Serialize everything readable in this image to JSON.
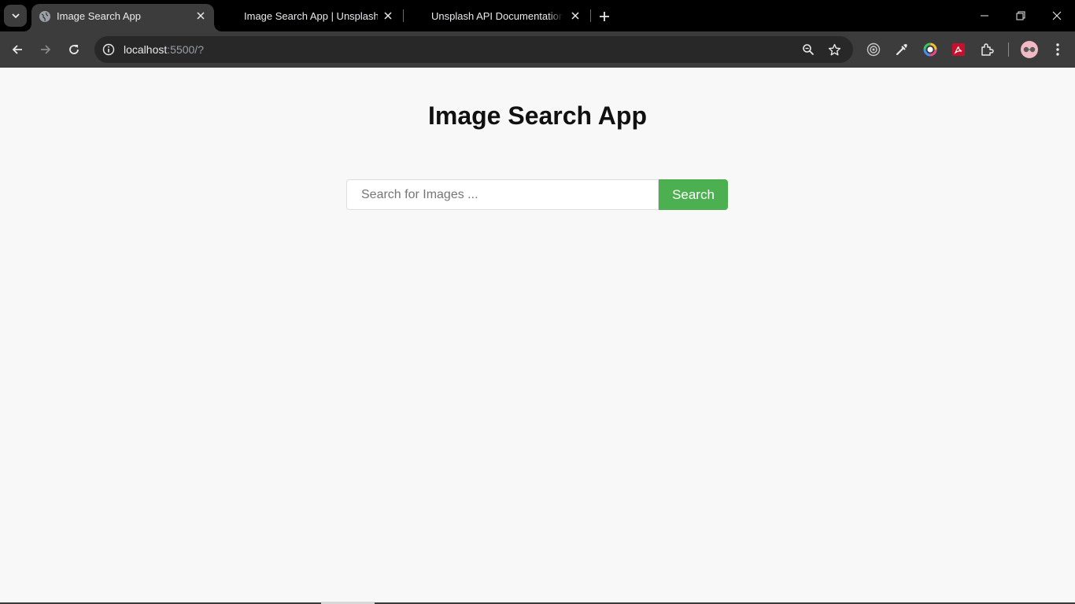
{
  "browser": {
    "tabs": [
      {
        "title": "Image Search App",
        "active": true
      },
      {
        "title": "Image Search App | Unsplash",
        "active": false
      },
      {
        "title": "Unsplash API Documentation | Free HD Photo API | Unsplash",
        "active": false
      }
    ],
    "address": {
      "host": "localhost",
      "rest": ":5500/?"
    },
    "icons": {
      "tab_search": "chevron-down-icon",
      "new_tab": "plus-icon",
      "minimize": "minimize-icon",
      "restore": "restore-icon",
      "close": "close-icon",
      "back": "arrow-left-icon",
      "forward": "arrow-right-icon",
      "reload": "reload-icon",
      "site_info": "info-icon",
      "zoom": "zoom-icon",
      "bookmark": "star-icon",
      "menu": "kebab-menu-icon"
    },
    "colors": {
      "frame": "#000000",
      "toolbar": "#3c3c3c",
      "omnibox": "#282828"
    }
  },
  "app": {
    "title": "Image Search App",
    "search": {
      "placeholder": "Search for Images ...",
      "value": "",
      "button_label": "Search"
    },
    "colors": {
      "background": "#f8f8f8",
      "button": "#4caf50",
      "button_text": "#ffffff"
    }
  }
}
